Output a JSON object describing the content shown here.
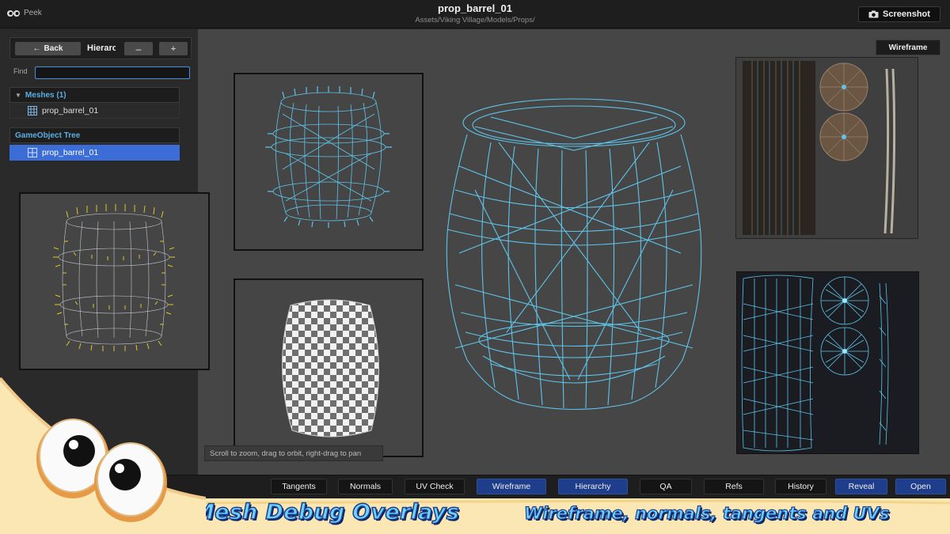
{
  "app": {
    "name": "Peek",
    "title": "prop_barrel_01",
    "path": "Assets/Viking Village/Models/Props/",
    "screenshot_label": "Screenshot"
  },
  "hierarchy": {
    "back_label": "Back",
    "panel_label": "Hierarchy",
    "minus_label": "–",
    "plus_label": "+",
    "find_label": "Find",
    "find_value": "",
    "meshes_header": "Meshes (1)",
    "mesh_item": "prop_barrel_01",
    "tree_header": "GameObject Tree",
    "tree_item": "prop_barrel_01"
  },
  "viewport": {
    "mode_label": "Wireframe",
    "scroll_hint": "Scroll to zoom, drag to orbit, right-drag to pan"
  },
  "toolbar": {
    "buttons": [
      {
        "label": "Tangents",
        "active": false
      },
      {
        "label": "Normals",
        "active": false
      },
      {
        "label": "UV Check",
        "active": false
      },
      {
        "label": "Wireframe",
        "active": true
      },
      {
        "label": "Hierarchy",
        "active": true
      },
      {
        "label": "QA",
        "active": false
      },
      {
        "label": "Refs",
        "active": false
      },
      {
        "label": "History",
        "active": false
      },
      {
        "label": "Reveal",
        "active": true
      },
      {
        "label": "Open",
        "active": true
      }
    ]
  },
  "banner": {
    "title": "Mesh Debug Overlays",
    "subtitle": "Wireframe, normals, tangents and UVs"
  },
  "colors": {
    "wire": "#5ec4ea",
    "normals": "#e6cf2a",
    "selection": "#3c6dd6",
    "active_button": "#1e3e8c",
    "banner_text": "#6fd1ff"
  }
}
